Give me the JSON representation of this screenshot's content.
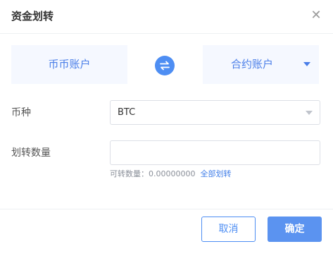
{
  "dialog": {
    "title": "资金划转",
    "close_icon": "close-icon"
  },
  "transfer": {
    "from_account": "币币账户",
    "to_account": "合约账户",
    "swap_icon": "swap-arrows-icon"
  },
  "form": {
    "currency_label": "币种",
    "currency_value": "BTC",
    "amount_label": "划转数量",
    "amount_value": "",
    "available_label": "可转数量：",
    "available_value": "0.00000000",
    "transfer_all_link": "全部划转"
  },
  "footer": {
    "cancel_label": "取消",
    "confirm_label": "确定"
  },
  "colors": {
    "accent": "#4e8ef3",
    "account_bg": "#f5f8ff",
    "confirm_bg": "#5b93f0"
  }
}
